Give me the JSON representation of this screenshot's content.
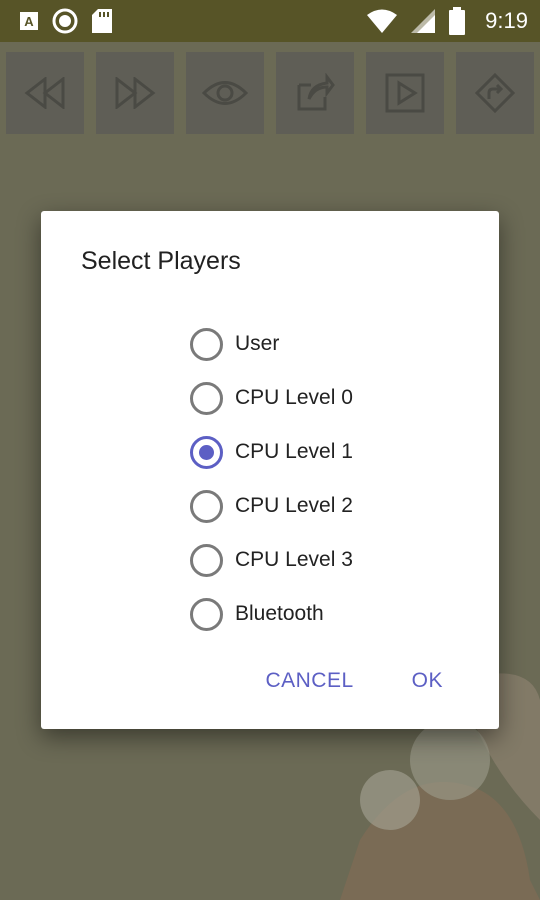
{
  "status_bar": {
    "time": "9:19",
    "left_icons": [
      "keyboard-a-icon",
      "circle-record-icon",
      "sd-card-icon"
    ],
    "right_icons": [
      "wifi-icon",
      "signal-icon",
      "battery-icon"
    ]
  },
  "toolbar": {
    "buttons": [
      "rewind-icon",
      "fast-forward-icon",
      "eye-icon",
      "share-icon",
      "play-icon",
      "directions-icon"
    ]
  },
  "dialog": {
    "title": "Select Players",
    "options": [
      {
        "label": "User",
        "checked": false
      },
      {
        "label": "CPU Level 0",
        "checked": false
      },
      {
        "label": "CPU Level 1",
        "checked": true
      },
      {
        "label": "CPU Level 2",
        "checked": false
      },
      {
        "label": "CPU Level 3",
        "checked": false
      },
      {
        "label": "Bluetooth",
        "checked": false
      }
    ],
    "cancel_label": "CANCEL",
    "ok_label": "OK"
  },
  "colors": {
    "accent": "#5c5fc4",
    "status_bar": "#575427"
  }
}
